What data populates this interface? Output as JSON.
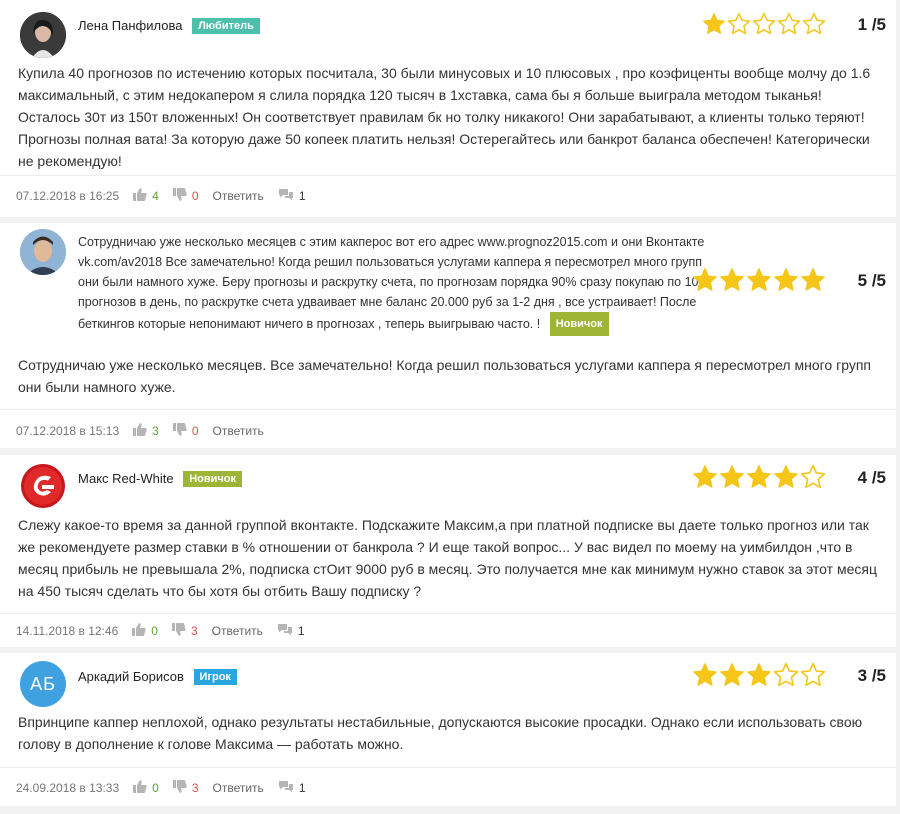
{
  "colors": {
    "star": "#f5c518",
    "badge_amateur": "#4cc0ad",
    "badge_novice": "#9cb534",
    "badge_player": "#29a6e0",
    "up": "#5ea336",
    "down": "#d9534f"
  },
  "reviews": [
    {
      "author": "Лена Панфилова",
      "badge": "Любитель",
      "rating": 1,
      "score": "1 /5",
      "text": "Купила 40 прогнозов по истечению которых посчитала, 30 были минусовых и 10 плюсовых , про коэфиценты вообще молчу до 1.6 максимальный, с этим недокапером я слила порядка 120 тысяч в 1хставка, сама бы я больше выиграла методом тыканья! Осталось 30т из 150т вложенных! Он соответствует правилам бк но толку никакого! Они зарабатывают, а клиенты только теряют! Прогнозы полная вата! За которую даже 50 копеек платить нельзя! Остерегайтесь или банкрот баланса обеспечен! Категорически не рекомендую!",
      "date": "07.12.2018 в 16:25",
      "likes": "4",
      "dislikes": "0",
      "reply": "Ответить",
      "comments": "1"
    },
    {
      "author": "",
      "badge": "Новичок",
      "rating": 5,
      "score": "5 /5",
      "snippet": "Сотрудничаю уже несколько месяцев с этим какперос вот его адрес www.prognoz2015.com и они Вконтакте vk.com/av2018 Все замечательно! Когда решил пользоваться услугами каппера я пересмотрел много групп они были намного хуже. Беру прогнозы и раскрутку счета, по прогнозам порядка 90% сразу покупаю по 10 прогнозов в день, по раскрутке счета удваивает мне баланс 20.000 руб за 1-2 дня , все устраивает! После беткингов которые непонимают ничего в прогнозах , теперь выигрываю часто. !",
      "text": "Сотрудничаю уже несколько месяцев. Все замечательно! Когда решил пользоваться услугами каппера я пересмотрел много групп они были намного хуже.",
      "date": "07.12.2018 в 15:13",
      "likes": "3",
      "dislikes": "0",
      "reply": "Ответить",
      "comments": ""
    },
    {
      "author": "Макс Red-White",
      "badge": "Новичок",
      "rating": 4,
      "score": "4 /5",
      "text": "Слежу какое-то время за данной группой вконтакте. Подскажите Максим,а при платной подписке вы даете только прогноз или так же рекомендуете размер ставки в % отношении от банкролa ? И еще такой вопрос... У вас видел по моему на уимбилдон ,что в месяц прибыль не превышала 2%, подписка стОит 9000 руб в месяц. Это получается мне как минимум нужно ставок за этот месяц на 450 тысяч сделать что бы хотя бы отбить Вашу подписку ?",
      "date": "14.11.2018 в 12:46",
      "likes": "0",
      "dislikes": "3",
      "reply": "Ответить",
      "comments": "1"
    },
    {
      "author": "Аркадий Борисов",
      "avatar_initials": "АБ",
      "badge": "Игрок",
      "rating": 3,
      "score": "3 /5",
      "text": "Впринципе каппер неплохой, однако результаты нестабильные, допускаются высокие просадки. Однако если использовать свою голову в дополнение к голове Максима — работать можно.",
      "date": "24.09.2018 в 13:33",
      "likes": "0",
      "dislikes": "3",
      "reply": "Ответить",
      "comments": "1"
    }
  ]
}
